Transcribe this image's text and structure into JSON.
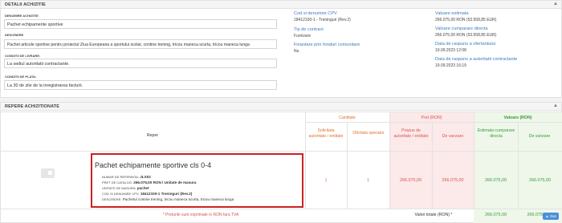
{
  "details": {
    "title": "DETALII ACHIZITIE",
    "denumire_label": "DENUMIRE ACHIZITIE",
    "denumire_value": "Pachet echipamente sportive",
    "descriere_label": "DESCRIERE",
    "descriere_value": "Pachet articole sportive pentru proiectul Ziua Europeana a sportului scolar, contine trening, tricou maneca scurta, tricou maneca lunga",
    "livrare_label": "CONDITII DE LIVRARE:",
    "livrare_value": "La sediul autoritatii contractante.",
    "plata_label": "CONDITII DE PLATA:",
    "plata_value": "La 30 de zile de la inregistrarea facturii.",
    "cpv_label": "Cod si denumire CPV",
    "cpv_value": "18412100-1 - Treninguri (Rev.2)",
    "tip_label": "Tip de contract",
    "tip_value": "Furnizare",
    "fonduri_label": "Finantare prin fonduri comunitare",
    "fonduri_value": "Nu",
    "estimata_label": "Valoare estimata",
    "estimata_value": "266.075,00  RON (53.558,85  EUR)",
    "directa_label": "Valoare cumparare directa",
    "directa_value": "266.075,00  RON (53.558,85  EUR)",
    "ofertare_label": "Data de raspuns a ofertantului",
    "ofertare_value": "19.09.2023 12:08",
    "autoritate_label": "Data de raspuns a autoritatii contractante",
    "autoritate_value": "19.09.2023 16:19"
  },
  "repere": {
    "title": "REPERE ACHIZITIONATE",
    "col_reper": "Reper",
    "grp_cantitate": "Cantitate",
    "grp_pret": "Pret (RON)",
    "grp_valoare": "Valoare (RON)",
    "col_solicitata": "Solicitata autoritate / entitate",
    "col_ofertata": "Ofertata operator",
    "col_propus": "Propus de autoritate / entitate",
    "col_vanzare": "De vanzare",
    "col_estimata": "Estimata cumparare directa",
    "col_val_vanzare": "De vanzare",
    "item": {
      "title": "Pachet echipamente sportive cls 0-4",
      "ref_label": "NUMAR DE REFERINTA:",
      "ref_value": "JLX02",
      "catalog_label": "PRET DE CATALOG:",
      "catalog_value": "266.075,00  RON / Unitate de masura",
      "um_label": "UNITATE DE MASURA:",
      "um_value": "pachet",
      "cpv_label": "COD SI DENUMIRE CPV:",
      "cpv_value": "18412100-1 Treninguri (Rev.2)",
      "desc_label": "DESCRIERE:",
      "desc_value": "Pachetul contine trening, tricou maneca scurta, tricou maneca lunga",
      "solicitata": "1",
      "ofertata": "1",
      "propus": "266.075,00",
      "vanzare": "266.075,00",
      "estimata": "266.075,00",
      "val_vanzare": "266.075,00"
    },
    "footnote": "* Preturile sunt exprimate in RON fara TVA",
    "totals_label": "Valori totale (RON) *",
    "total_estimata": "266.075,00",
    "total_vanzare": "266.075,00"
  },
  "scroll_top_label": "▲ Sus"
}
